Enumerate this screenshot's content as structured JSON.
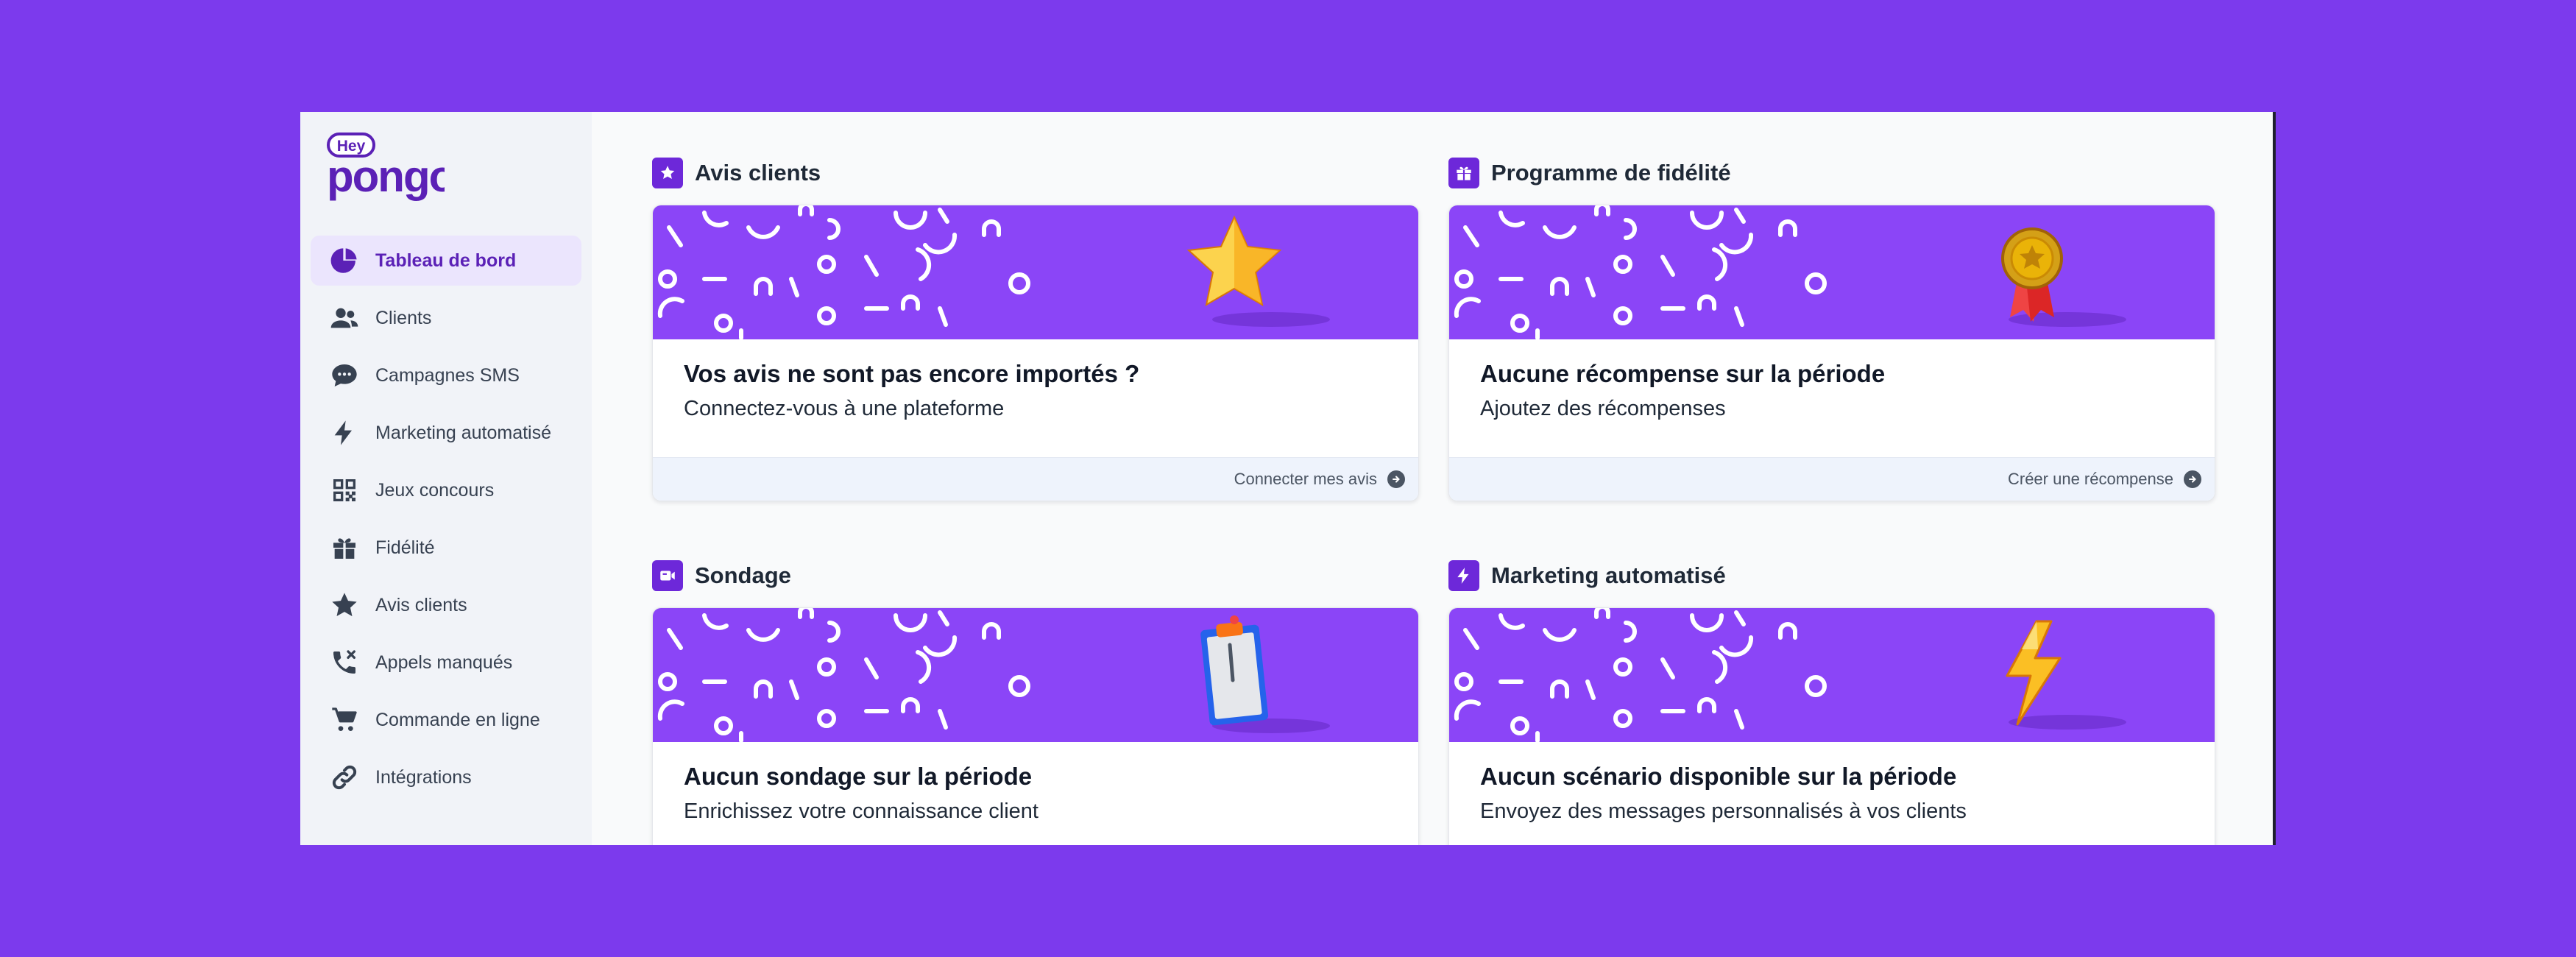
{
  "app": {
    "logo_top": "Hey",
    "logo_bottom": "pongo"
  },
  "sidebar": {
    "items": [
      {
        "label": "Tableau de bord",
        "icon": "pie-chart-icon",
        "active": true
      },
      {
        "label": "Clients",
        "icon": "users-icon"
      },
      {
        "label": "Campagnes SMS",
        "icon": "chat-bubble-icon"
      },
      {
        "label": "Marketing automatisé",
        "icon": "lightning-icon"
      },
      {
        "label": "Jeux concours",
        "icon": "qr-code-icon"
      },
      {
        "label": "Fidélité",
        "icon": "gift-icon"
      },
      {
        "label": "Avis clients",
        "icon": "star-icon"
      },
      {
        "label": "Appels manqués",
        "icon": "missed-call-icon"
      },
      {
        "label": "Commande en ligne",
        "icon": "cart-icon"
      },
      {
        "label": "Intégrations",
        "icon": "link-icon"
      }
    ]
  },
  "sections": [
    {
      "title": "Avis clients",
      "icon": "star-icon",
      "illustration": "star",
      "card_title": "Vos avis ne sont pas encore importés ?",
      "card_subtitle": "Connectez-vous à une plateforme",
      "cta": "Connecter mes avis"
    },
    {
      "title": "Programme de fidélité",
      "icon": "gift-icon",
      "illustration": "medal",
      "card_title": "Aucune récompense sur la période",
      "card_subtitle": "Ajoutez des récompenses",
      "cta": "Créer une récompense"
    },
    {
      "title": "Sondage",
      "icon": "video-icon",
      "illustration": "clipboard",
      "card_title": "Aucun sondage sur la période",
      "card_subtitle": "Enrichissez votre connaissance client",
      "cta": ""
    },
    {
      "title": "Marketing automatisé",
      "icon": "lightning-icon",
      "illustration": "lightning",
      "card_title": "Aucun scénario disponible sur la période",
      "card_subtitle": "Envoyez des messages personnalisés à vos clients",
      "cta": ""
    }
  ],
  "colors": {
    "accent": "#6d28d9",
    "background": "#7c3aed",
    "banner": "#8b45f7"
  }
}
